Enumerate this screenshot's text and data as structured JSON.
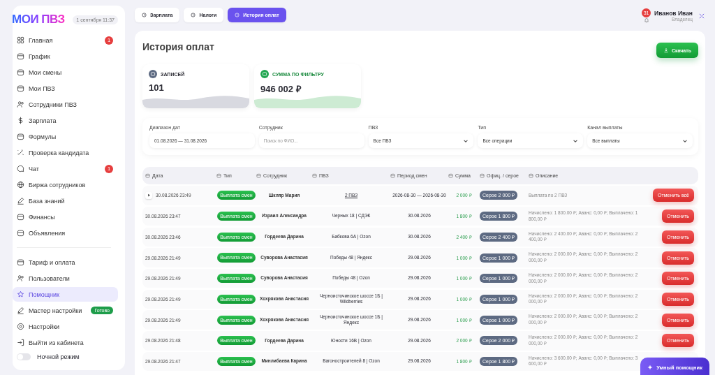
{
  "sidebar": {
    "logo": "МОИ ПВЗ",
    "date": "1 сентября 11:37",
    "items": [
      {
        "label": "Главная",
        "selected": false,
        "badge": "1"
      },
      {
        "label": "График",
        "selected": false
      },
      {
        "label": "Мои смены",
        "selected": false
      },
      {
        "label": "Мои ПВЗ",
        "selected": false
      },
      {
        "label": "Сотрудники ПВЗ",
        "selected": false
      },
      {
        "label": "Зарплата",
        "selected": false
      },
      {
        "label": "Формулы",
        "selected": false
      },
      {
        "label": "Проверка кандидата",
        "selected": false
      },
      {
        "label": "Чат",
        "selected": false,
        "badge": "1"
      },
      {
        "label": "Биржа сотрудников",
        "selected": false
      },
      {
        "label": "База знаний",
        "selected": false
      },
      {
        "label": "Финансы",
        "selected": false
      },
      {
        "label": "Объявления",
        "selected": false
      }
    ],
    "bottom_items": [
      {
        "label": "Тариф и оплата",
        "selected": false
      },
      {
        "label": "Пользователи",
        "selected": false
      },
      {
        "label": "Помощник",
        "selected": true
      },
      {
        "label": "Мастер настройки",
        "selected": false,
        "tag": "Готово"
      },
      {
        "label": "Настройки",
        "selected": false
      },
      {
        "label": "Выйти из кабинета",
        "selected": false
      }
    ],
    "night_mode": {
      "label": "Ночной режим",
      "on": false
    }
  },
  "tabs": [
    {
      "label": "Зарплата",
      "selected": false
    },
    {
      "label": "Налоги",
      "selected": false
    },
    {
      "label": "История оплат",
      "selected": true
    }
  ],
  "user": {
    "name": "Иванов Иван",
    "role": "Владелец",
    "notifications": "31"
  },
  "page": {
    "title": "История оплат",
    "download": "Скачать"
  },
  "stats": [
    {
      "label": "ЗАПИСЕЙ",
      "value": "101",
      "kind": "neutral"
    },
    {
      "label": "СУММА ПО ФИЛЬТРУ",
      "value": "946 002 ₽",
      "kind": "green"
    }
  ],
  "filters": [
    {
      "label": "Диапазон дат",
      "value": "01.08.2026 — 31.08.2026",
      "kind": "input"
    },
    {
      "label": "Сотрудник",
      "placeholder": "Поиск по ФИО...",
      "kind": "input"
    },
    {
      "label": "ПВЗ",
      "value": "Все ПВЗ",
      "kind": "select"
    },
    {
      "label": "Тип",
      "value": "Все операции",
      "kind": "select"
    },
    {
      "label": "Канал выплаты",
      "value": "Все выплаты",
      "kind": "select"
    }
  ],
  "table": {
    "columns": [
      "Дата",
      "Тип",
      "Сотрудник",
      "ПВЗ",
      "Период смен",
      "Сумма",
      "Офиц. / серое",
      "Описание"
    ],
    "rows": [
      {
        "date": "30.08.2026 23:49",
        "type": "Выплата смен",
        "employee": "Шкляр Мария",
        "pvz": "2 ПВЗ",
        "period": "2026-08-30 — 2026-08-30",
        "sum": "2 000 ₽",
        "badge": "Серое 2 000 ₽",
        "description": "Выплата по 2 ПВЗ",
        "action": "Отменить всё",
        "expandable": true
      },
      {
        "date": "30.08.2026 23:47",
        "type": "Выплата смен",
        "employee": "Израил Александра",
        "pvz": "Черных 18 | СДЭК",
        "period": "30.08.2026",
        "sum": "1 800 ₽",
        "badge": "Серое 1 800 ₽",
        "description": "Начислено: 1 800.00 ₽; Аванс: 0,00 ₽; Выплачено: 1 800,00 ₽",
        "action": "Отменить",
        "expandable": false
      },
      {
        "date": "30.08.2026 23:46",
        "type": "Выплата смен",
        "employee": "Гордеева Дарина",
        "pvz": "Бабкова 6А | Ozon",
        "period": "30.08.2026",
        "sum": "2 400 ₽",
        "badge": "Серое 2 400 ₽",
        "description": "Начислено: 2 400.00 ₽; Аванс: 0,00 ₽; Выплачено: 2 400,00 ₽",
        "action": "Отменить",
        "expandable": false
      },
      {
        "date": "29.08.2026 21:49",
        "type": "Выплата смен",
        "employee": "Суворова Анастасия",
        "pvz": "Победы 48 | Яндекс",
        "period": "29.08.2026",
        "sum": "1 000 ₽",
        "badge": "Серое 1 000 ₽",
        "description": "Начислено: 2 000.00 ₽; Аванс: 0,00 ₽; Выплачено: 2 000,00 ₽",
        "action": "Отменить",
        "expandable": false
      },
      {
        "date": "29.08.2026 21:49",
        "type": "Выплата смен",
        "employee": "Суворова Анастасия",
        "pvz": "Победы 48 | Ozon",
        "period": "29.08.2026",
        "sum": "1 000 ₽",
        "badge": "Серое 1 000 ₽",
        "description": "Начислено: 2 000.00 ₽; Аванс: 0,00 ₽; Выплачено: 2 000,00 ₽",
        "action": "Отменить",
        "expandable": false
      },
      {
        "date": "29.08.2026 21:49",
        "type": "Выплата смен",
        "employee": "Хохрякова Анастасия",
        "pvz": "Черноисточинское шоссе 1Б | Wildberries",
        "period": "29.08.2026",
        "sum": "1 000 ₽",
        "badge": "Серое 1 000 ₽",
        "description": "Начислено: 2 000.00 ₽; Аванс: 0,00 ₽; Выплачено: 2 000,00 ₽",
        "action": "Отменить",
        "expandable": false
      },
      {
        "date": "29.08.2026 21:49",
        "type": "Выплата смен",
        "employee": "Хохрякова Анастасия",
        "pvz": "Черноисточинское шоссе 1Б | Яндекс",
        "period": "29.08.2026",
        "sum": "1 000 ₽",
        "badge": "Серое 1 000 ₽",
        "description": "Начислено: 2 000.00 ₽; Аванс: 0,00 ₽; Выплачено: 2 000,00 ₽",
        "action": "Отменить",
        "expandable": false
      },
      {
        "date": "29.08.2026 21:48",
        "type": "Выплата смен",
        "employee": "Гордеева Дарина",
        "pvz": "Юности 16В | Ozon",
        "period": "29.08.2026",
        "sum": "2 000 ₽",
        "badge": "Серое 2 000 ₽",
        "description": "Начислено: 2 000.00 ₽; Аванс: 0,00 ₽; Выплачено: 2 000,00 ₽",
        "action": "Отменить",
        "expandable": false
      },
      {
        "date": "29.08.2026 21:47",
        "type": "Выплата смен",
        "employee": "Минлибаева Карина",
        "pvz": "Вагоностроителей 8 | Ozon",
        "period": "29.08.2026",
        "sum": "1 800 ₽",
        "badge": "Серое 1 800 ₽",
        "description": "Начислено: 3 600.00 ₽; Аванс: 0,00 ₽; Выплачено: 3 600,00 ₽",
        "expandable": false
      }
    ]
  },
  "assistant_button": "Умный помощник"
}
